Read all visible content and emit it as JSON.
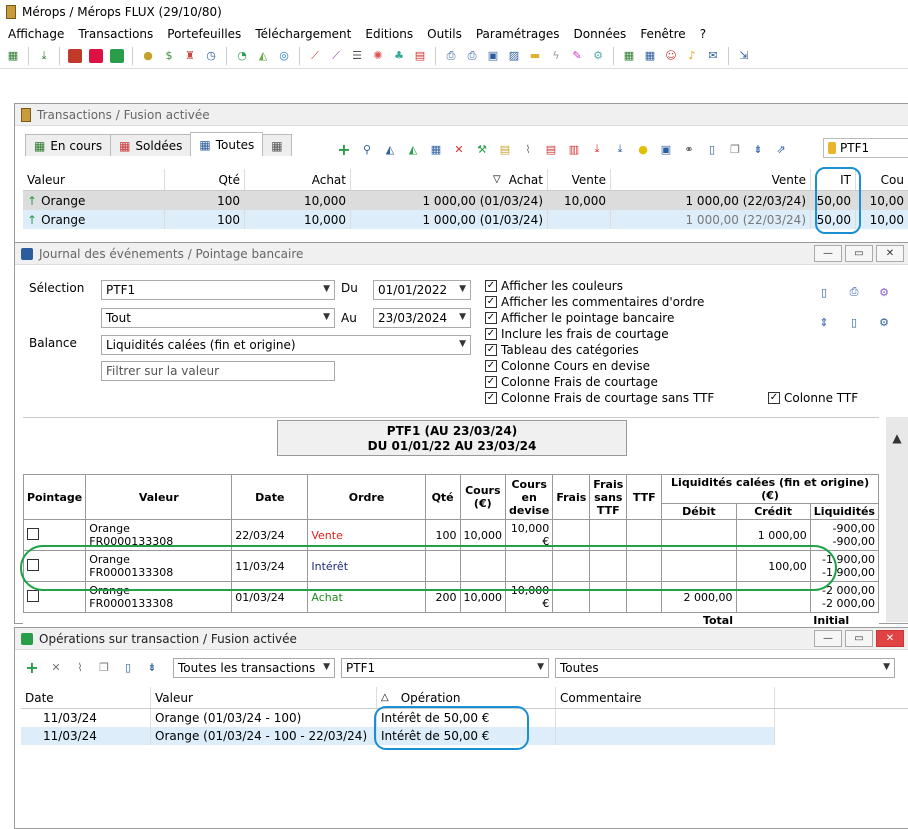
{
  "app": {
    "title": "Mérops / Mérops FLUX (29/10/80)"
  },
  "menu": [
    "Affichage",
    "Transactions",
    "Portefeuilles",
    "Téléchargement",
    "Editions",
    "Outils",
    "Paramétrages",
    "Données",
    "Fenêtre",
    "?"
  ],
  "win_transactions": {
    "title": "Transactions / Fusion activée",
    "tabs": [
      "En cours",
      "Soldées",
      "Toutes"
    ],
    "portfolio": "PTF1",
    "columns": [
      "Valeur",
      "Qté",
      "Achat",
      "Achat",
      "Vente",
      "Vente",
      "IT",
      "Cou"
    ],
    "rows": [
      {
        "valeur": "Orange",
        "qte": "100",
        "achat": "10,000",
        "achat2": "1 000,00 (01/03/24)",
        "vente": "10,000",
        "vente2": "1 000,00 (22/03/24)",
        "it": "50,00",
        "cou": "10,00"
      },
      {
        "valeur": "Orange",
        "qte": "100",
        "achat": "10,000",
        "achat2": "1 000,00 (01/03/24)",
        "vente": "",
        "vente2": "1 000,00 (22/03/24)",
        "it": "50,00",
        "cou": "10,00"
      }
    ]
  },
  "win_journal": {
    "title": "Journal des événements / Pointage bancaire",
    "selection_label": "Sélection",
    "selection_value": "PTF1",
    "scope_value": "Tout",
    "du_label": "Du",
    "du_value": "01/01/2022",
    "au_label": "Au",
    "au_value": "23/03/2024",
    "balance_label": "Balance",
    "balance_value": "Liquidités calées (fin et origine)",
    "filter_placeholder": "Filtrer sur la valeur",
    "checkboxes": [
      "Afficher les couleurs",
      "Afficher les commentaires d'ordre",
      "Afficher le pointage bancaire",
      "Inclure les frais de courtage",
      "Tableau des catégories",
      "Colonne Cours en devise",
      "Colonne Frais de courtage",
      "Colonne Frais de courtage sans TTF"
    ],
    "ttf_checkbox": "Colonne TTF",
    "report_title_1": "PTF1 (AU 23/03/24)",
    "report_title_2": "DU 01/01/22 AU 23/03/24",
    "table_headers": [
      "Pointage",
      "Valeur",
      "Date",
      "Ordre",
      "Qté",
      "Cours (€)",
      "Cours en devise",
      "Frais",
      "Frais sans TTF",
      "TTF",
      "Liquidités calées (fin et origine) (€)",
      "Débit",
      "Crédit",
      "Liquidités"
    ],
    "rows": [
      {
        "valeur": "Orange",
        "isin": "FR0000133308",
        "date": "22/03/24",
        "ordre": "Vente",
        "ordre_color": "#d81f1f",
        "qte": "100",
        "cours": "10,000",
        "cours_devise": "10,000 €",
        "debit": "",
        "credit": "1 000,00",
        "liq1": "-900,00",
        "liq2": "-900,00"
      },
      {
        "valeur": "Orange",
        "isin": "FR0000133308",
        "date": "11/03/24",
        "ordre": "Intérêt",
        "ordre_color": "#1f2a7a",
        "qte": "",
        "cours": "",
        "cours_devise": "",
        "debit": "",
        "credit": "100,00",
        "liq1": "-1 900,00",
        "liq2": "-1 900,00"
      },
      {
        "valeur": "Orange",
        "isin": "FR0000133308",
        "date": "01/03/24",
        "ordre": "Achat",
        "ordre_color": "#1e8a1e",
        "qte": "200",
        "cours": "10,000",
        "cours_devise": "10,000 €",
        "debit": "2 000,00",
        "credit": "",
        "liq1": "-2 000,00",
        "liq2": "-2 000,00"
      }
    ],
    "footer_total": "Total",
    "footer_initial": "Initial"
  },
  "win_operations": {
    "title": "Opérations sur transaction / Fusion activée",
    "filter_type": "Toutes les transactions",
    "filter_portfolio": "PTF1",
    "filter_all": "Toutes",
    "columns": [
      "Date",
      "Valeur",
      "Opération",
      "Commentaire"
    ],
    "rows": [
      {
        "date": "11/03/24",
        "valeur": "Orange (01/03/24 - 100)",
        "operation": "Intérêt de 50,00 €",
        "commentaire": ""
      },
      {
        "date": "11/03/24",
        "valeur": "Orange (01/03/24 - 100 - 22/03/24)",
        "operation": "Intérêt de 50,00 €",
        "commentaire": ""
      }
    ]
  },
  "colors": {
    "green_highlight": "#21a24a",
    "blue_highlight": "#1b8fd4",
    "row_selected": "#ddeefa"
  }
}
